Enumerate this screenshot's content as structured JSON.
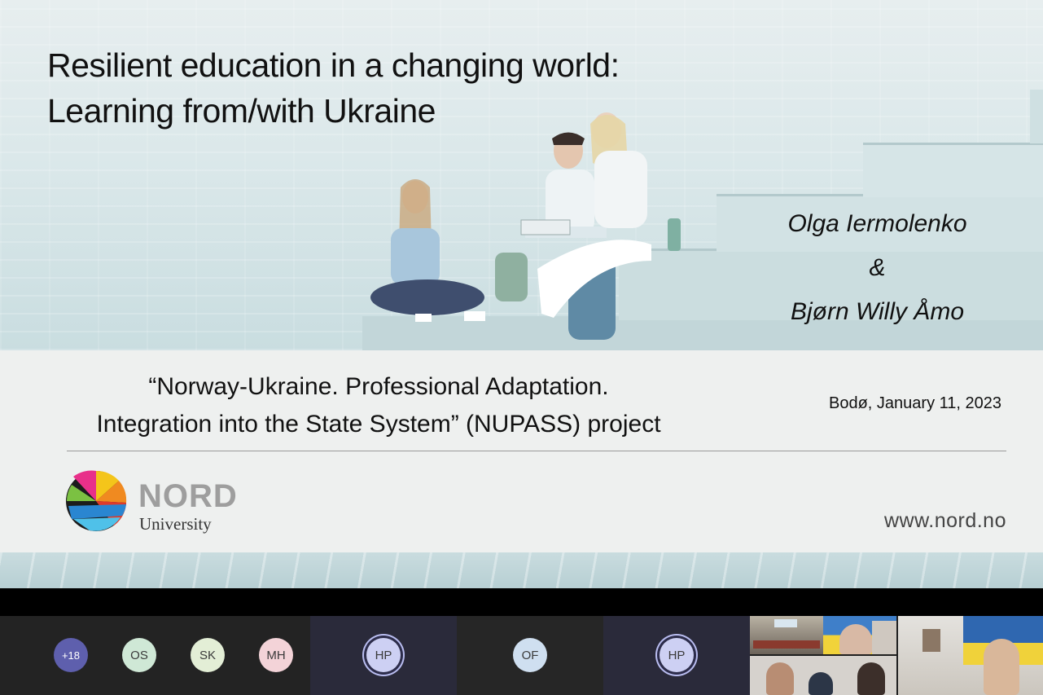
{
  "slide": {
    "title_lines": [
      "Resilient education in a changing world:",
      "Learning from/with Ukraine"
    ],
    "authors": [
      "Olga Iermolenko",
      "&",
      "Bjørn Willy Åmo"
    ],
    "project_lines": [
      "“Norway-Ukraine. Professional Adaptation.",
      "Integration into the State System” (NUPASS) project"
    ],
    "date": "Bodø, January 11, 2023",
    "logo": {
      "name": "NORD",
      "sub": "University"
    },
    "website": "www.nord.no"
  },
  "participants": {
    "overflow": "+18",
    "initials": [
      "OS",
      "SK",
      "MH"
    ],
    "tiles": [
      "HP",
      "OF",
      "HP"
    ],
    "colors": {
      "overflow": "#5e5fad",
      "OS": "#cfe8d6",
      "SK": "#e3eed6",
      "MH": "#f3d3d8",
      "HP": "#cdd0f3",
      "OF": "#cfdff0"
    }
  }
}
